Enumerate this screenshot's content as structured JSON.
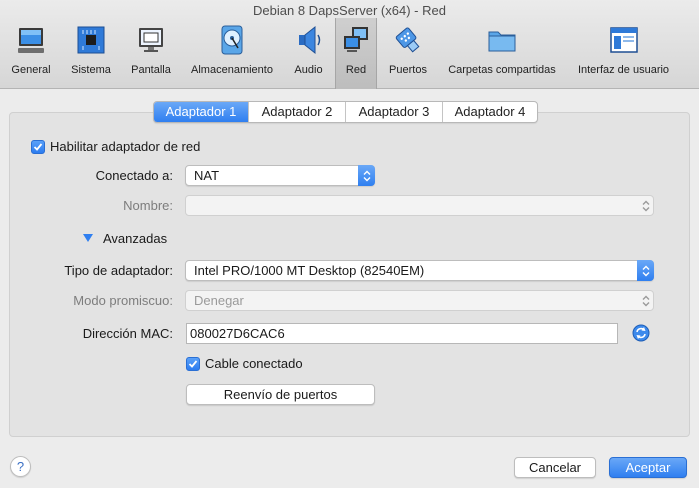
{
  "window": {
    "title": "Debian 8 DapsServer (x64) - Red"
  },
  "toolbar": {
    "items": [
      {
        "label": "General",
        "icon": "monitor-screen-icon"
      },
      {
        "label": "Sistema",
        "icon": "chip-board-icon"
      },
      {
        "label": "Pantalla",
        "icon": "display-icon"
      },
      {
        "label": "Almacenamiento",
        "icon": "hard-disk-icon"
      },
      {
        "label": "Audio",
        "icon": "speaker-icon"
      },
      {
        "label": "Red",
        "icon": "network-icon",
        "selected": true
      },
      {
        "label": "Puertos",
        "icon": "serial-port-icon"
      },
      {
        "label": "Carpetas compartidas",
        "icon": "folder-icon"
      },
      {
        "label": "Interfaz de usuario",
        "icon": "window-ui-icon"
      }
    ]
  },
  "tabs": [
    "Adaptador 1",
    "Adaptador 2",
    "Adaptador 3",
    "Adaptador 4"
  ],
  "adapter": {
    "enable_label": "Habilitar adaptador de red",
    "enable_checked": true,
    "attached_label": "Conectado a:",
    "attached_value": "NAT",
    "name_label": "Nombre:",
    "name_value": "",
    "advanced_label": "Avanzadas",
    "type_label": "Tipo de adaptador:",
    "type_value": "Intel PRO/1000 MT Desktop (82540EM)",
    "promisc_label": "Modo promiscuo:",
    "promisc_value": "Denegar",
    "mac_label": "Dirección MAC:",
    "mac_value": "080027D6CAC6",
    "cable_label": "Cable conectado",
    "cable_checked": true,
    "port_forward_label": "Reenvío de puertos"
  },
  "footer": {
    "help_label": "?",
    "cancel_label": "Cancelar",
    "accept_label": "Aceptar"
  },
  "colors": {
    "accent": "#2f7ff0",
    "panel": "#e3e3e3"
  }
}
